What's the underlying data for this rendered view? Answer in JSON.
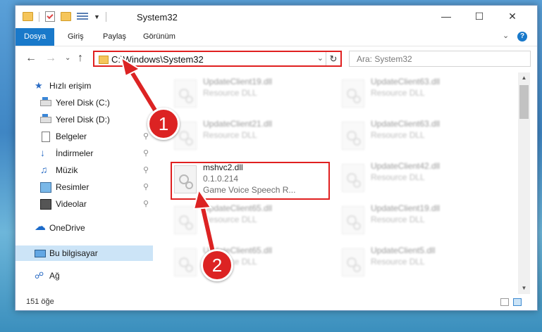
{
  "window": {
    "title": "System32"
  },
  "ribbon": {
    "tabs": [
      "Dosya",
      "Giriş",
      "Paylaş",
      "Görünüm"
    ],
    "help": "?"
  },
  "address": {
    "path": "C:\\Windows\\System32"
  },
  "search": {
    "placeholder": "Ara: System32"
  },
  "nav": {
    "items": [
      {
        "label": "Hızlı erişim",
        "icon": "star-icon"
      },
      {
        "label": "Yerel Disk (C:)",
        "icon": "drive-icon"
      },
      {
        "label": "Yerel Disk (D:)",
        "icon": "drive-icon"
      },
      {
        "label": "Belgeler",
        "icon": "document-icon",
        "pinned": true
      },
      {
        "label": "İndirmeler",
        "icon": "download-icon",
        "pinned": true
      },
      {
        "label": "Müzik",
        "icon": "music-icon",
        "pinned": true
      },
      {
        "label": "Resimler",
        "icon": "pictures-icon",
        "pinned": true
      },
      {
        "label": "Videolar",
        "icon": "videos-icon",
        "pinned": true
      },
      {
        "label": "OneDrive",
        "icon": "onedrive-icon"
      },
      {
        "label": "Bu bilgisayar",
        "icon": "pc-icon",
        "selected": true
      },
      {
        "label": "Ağ",
        "icon": "network-icon"
      }
    ]
  },
  "files": [
    {
      "name": "UpdateClient19.dll",
      "desc": "Resource DLL"
    },
    {
      "name": "UpdateClient63.dll",
      "desc": "Resource DLL"
    },
    {
      "name": "UpdateClient21.dll",
      "desc": "Resource DLL"
    },
    {
      "name": "UpdateClient63.dll",
      "desc": "Resource DLL"
    },
    {
      "name": "mshvc2.dll",
      "version": "0.1.0.214",
      "desc": "Game Voice Speech R..."
    },
    {
      "name": "UpdateClient42.dll",
      "desc": "Resource DLL"
    },
    {
      "name": "UpdateClient65.dll",
      "desc": "Resource DLL"
    },
    {
      "name": "UpdateClient19.dll",
      "desc": "Resource DLL"
    },
    {
      "name": "UpdateClient65.dll",
      "desc": "Resource DLL"
    },
    {
      "name": "UpdateClient5.dll",
      "desc": "Resource DLL"
    }
  ],
  "status": {
    "count": "151 öğe"
  },
  "callouts": [
    "1",
    "2"
  ],
  "colors": {
    "accent": "#1979ca",
    "highlight": "#e02020",
    "selected": "#cce4f7"
  }
}
